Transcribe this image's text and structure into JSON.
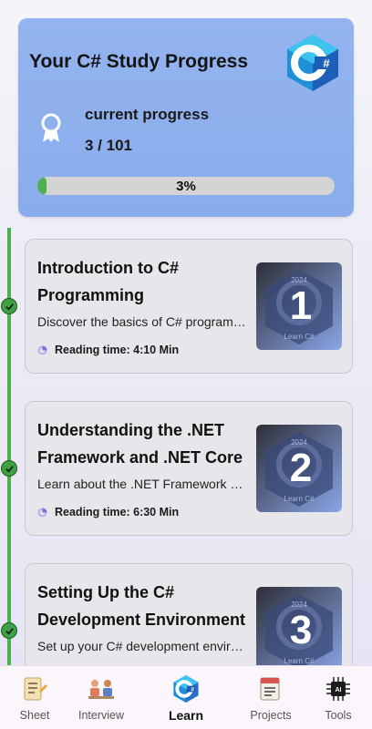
{
  "progress": {
    "title": "Your C# Study Progress",
    "label": "current progress",
    "count": "3 / 101",
    "percent_text": "3%",
    "percent_value": 0.03
  },
  "lessons": [
    {
      "title": "Introduction to C# Programming",
      "description": "Discover the basics of C# programming",
      "reading_time": "Reading time: 4:10 Min",
      "number": "1",
      "badge_year": "2024",
      "badge_caption": "Learn C#",
      "completed": true
    },
    {
      "title": "Understanding the .NET Framework and .NET Core",
      "description": "Learn about the .NET Framework and .NET Core",
      "reading_time": "Reading time: 6:30 Min",
      "number": "2",
      "badge_year": "2024",
      "badge_caption": "Learn C#",
      "completed": true
    },
    {
      "title": "Setting Up the C# Development Environment",
      "description": "Set up your C# development environment",
      "reading_time": "",
      "number": "3",
      "badge_year": "2024",
      "badge_caption": "Learn C#",
      "completed": true
    }
  ],
  "nav": {
    "items": [
      {
        "label": "Sheet",
        "icon": "sheet-icon"
      },
      {
        "label": "Interview",
        "icon": "interview-icon"
      },
      {
        "label": "Learn",
        "icon": "csharp-icon",
        "active": true
      },
      {
        "label": "Projects",
        "icon": "projects-icon"
      },
      {
        "label": "Tools",
        "icon": "ai-chip-icon"
      }
    ]
  },
  "colors": {
    "accent_green": "#4caf50",
    "card_blue": "#8fb0ee",
    "csharp_purple": "#6a3fa0",
    "csharp_cyan": "#37b8e8"
  }
}
